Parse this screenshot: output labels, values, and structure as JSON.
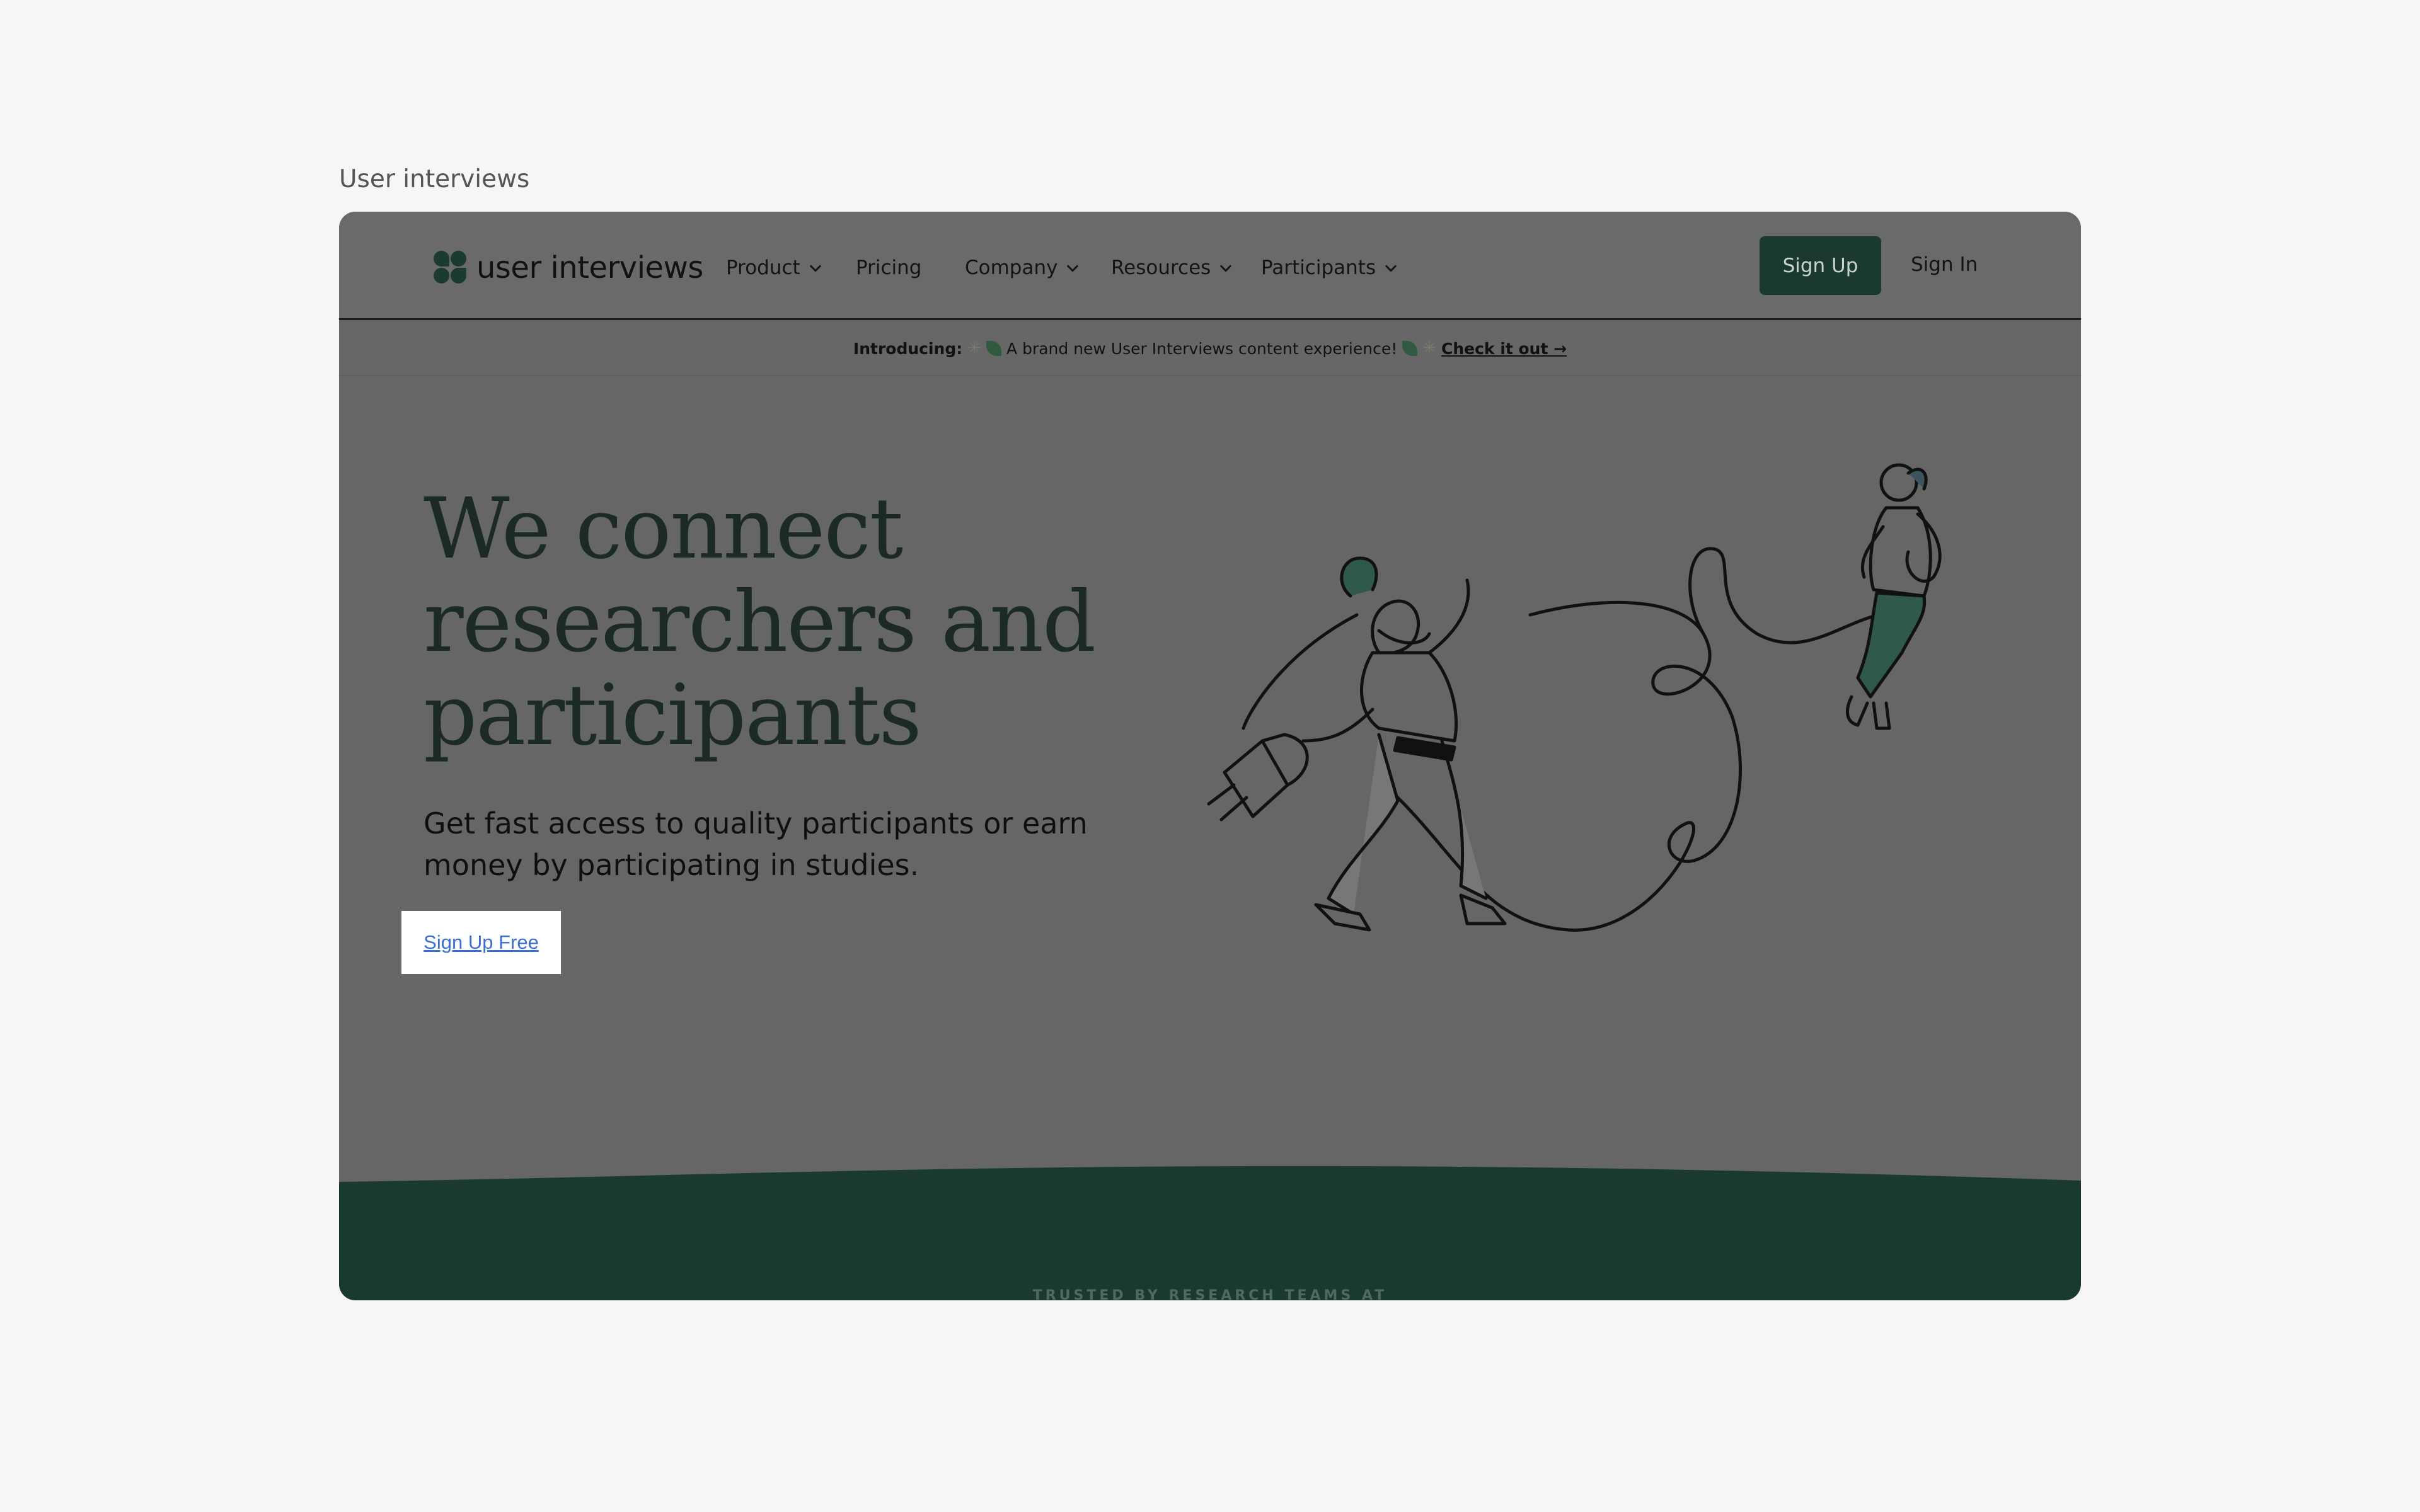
{
  "caption": "User interviews",
  "nav": {
    "logo_text": "user interviews",
    "items": [
      {
        "label": "Product",
        "has_dropdown": true
      },
      {
        "label": "Pricing",
        "has_dropdown": false
      },
      {
        "label": "Company",
        "has_dropdown": true
      },
      {
        "label": "Resources",
        "has_dropdown": true
      },
      {
        "label": "Participants",
        "has_dropdown": true
      }
    ],
    "signup_label": "Sign Up",
    "signin_label": "Sign In"
  },
  "announcement": {
    "prefix": "Introducing:",
    "text": "A brand new User Interviews content experience!",
    "link": "Check it out →"
  },
  "hero": {
    "headline_1": "We connect",
    "headline_2": "researchers and",
    "headline_3": "participants",
    "subline": "Get fast access to quality participants or earn money by participating in studies.",
    "cta_label": "Sign Up Free"
  },
  "trusted": "TRUSTED BY RESEARCH TEAMS AT",
  "colors": {
    "page_bg": "#f6f6f6",
    "overlay": "#666666",
    "brand_green": "#1a3a30",
    "link_blue": "#3a6fd0"
  }
}
